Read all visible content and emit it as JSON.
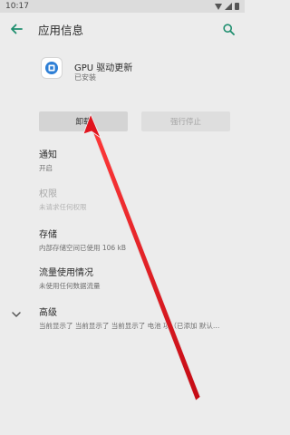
{
  "status_bar": {
    "time": "10:17"
  },
  "toolbar": {
    "back_icon": "arrow-left-icon",
    "title": "应用信息",
    "search_icon": "search-icon"
  },
  "app": {
    "name": "GPU 驱动更新",
    "status": "已安装"
  },
  "buttons": {
    "uninstall": "卸载",
    "force_stop": "强行停止"
  },
  "settings": [
    {
      "title": "通知",
      "subtitle": "开启",
      "enabled": true
    },
    {
      "title": "权限",
      "subtitle": "未请求任何权限",
      "enabled": false
    },
    {
      "title": "存储",
      "subtitle": "内部存储空间已使用 106 kB",
      "enabled": true
    },
    {
      "title": "流量使用情况",
      "subtitle": "未使用任何数据流量",
      "enabled": true
    },
    {
      "title": "高级",
      "subtitle": "当前显示了  当前显示了  当前显示了 电池  项（已添加 默认…",
      "enabled": true
    }
  ],
  "colors": {
    "accent": "#1e8e6e",
    "arrow": "#e0141e",
    "background": "#ececec"
  }
}
